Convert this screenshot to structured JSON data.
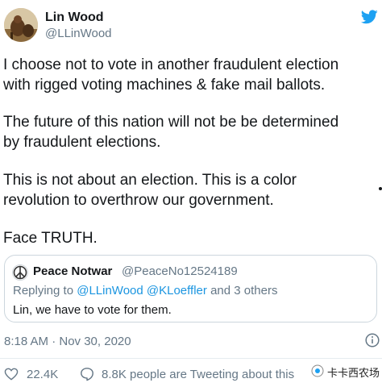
{
  "author": {
    "name": "Lin Wood",
    "handle": "@LLinWood"
  },
  "tweet": {
    "paragraphs": [
      [
        "I choose not to vote in another fraudulent election",
        "with rigged voting machines & fake mail ballots."
      ],
      [
        "The future of this nation will not be be determined",
        "by fraudulent elections."
      ],
      [
        "This is not about an election. This is a color",
        "revolution to overthrow our government."
      ],
      [
        "Face TRUTH."
      ]
    ],
    "timestamp": "8:18 AM · Nov 30, 2020"
  },
  "quoted_tweet": {
    "name": "Peace Notwar",
    "handle": "@PeaceNo12524189",
    "reply_prefix": "Replying to",
    "reply_mention_1": "@LLinWood",
    "reply_mention_2": "@KLoeffler",
    "reply_suffix": "and 3 others",
    "text": "Lin, we have to vote for them."
  },
  "actions": {
    "likes": "22.4K",
    "discussion": "8.8K people are Tweeting about this"
  },
  "watermark": {
    "text": "卡卡西农场"
  },
  "colors": {
    "twitter_blue": "#1da1f2",
    "link_blue": "#1b95e0",
    "secondary_text": "#657786",
    "border": "#ccd6dd"
  },
  "icons": {
    "brand": "twitter-bird-icon",
    "info": "info-icon",
    "like": "heart-icon",
    "discussion": "speech-bubble-icon"
  }
}
